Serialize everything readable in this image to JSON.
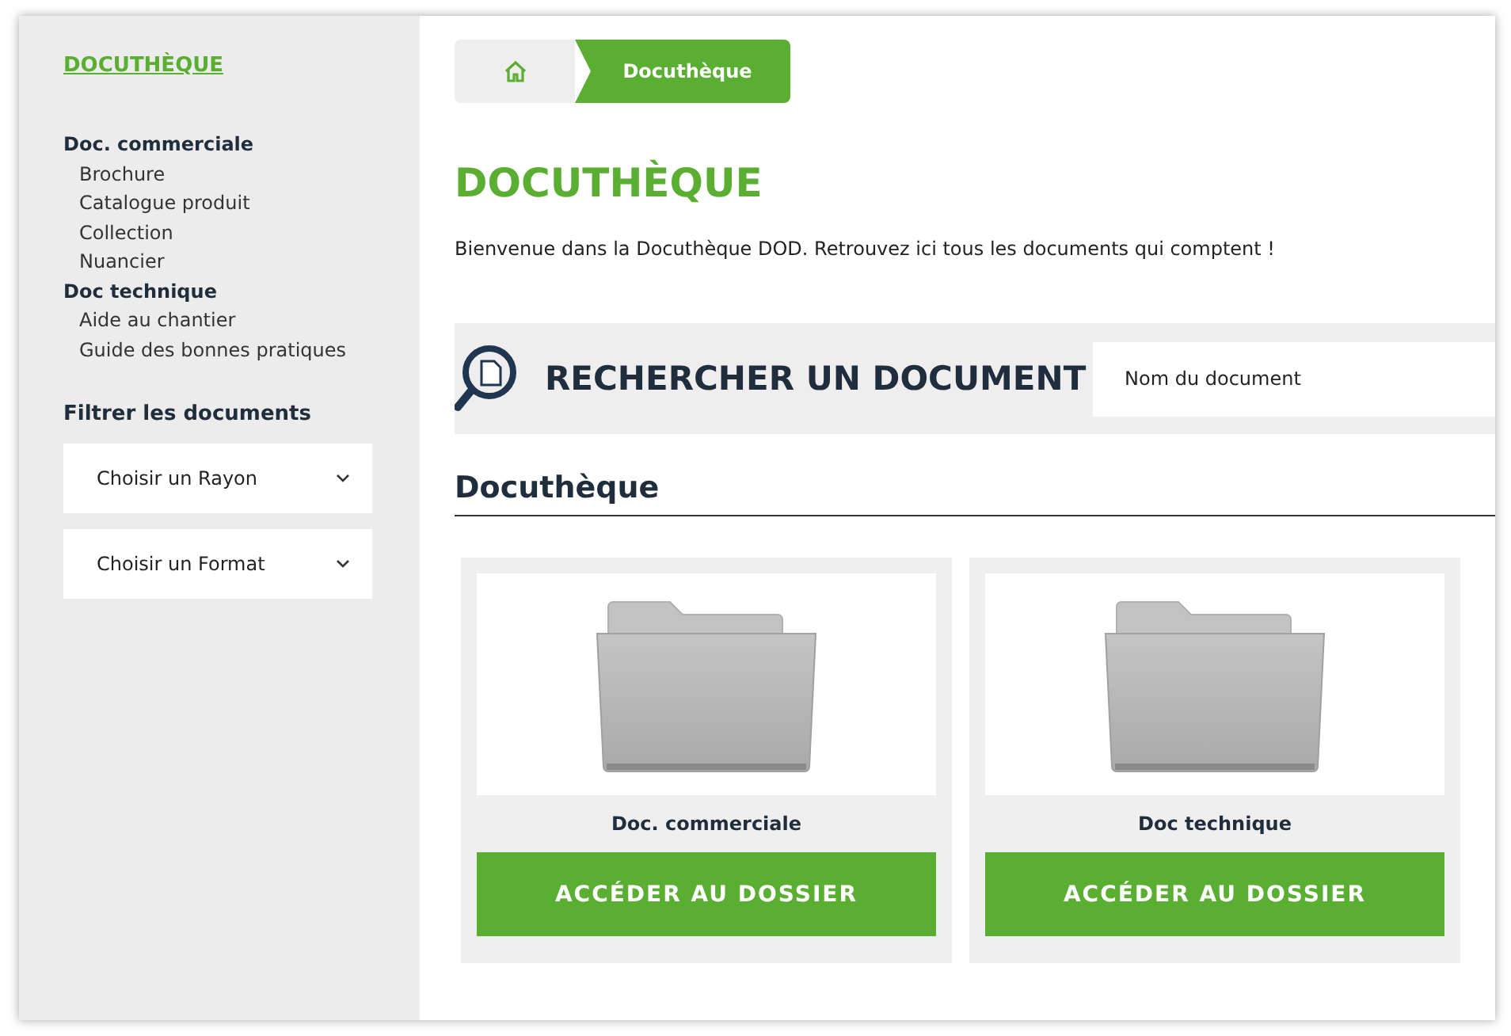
{
  "sidebar": {
    "title": "DOCUTHÈQUE",
    "tree": [
      {
        "label": "Doc. commerciale",
        "children": [
          {
            "label": "Brochure"
          },
          {
            "label": "Catalogue produit"
          },
          {
            "label": "Collection"
          },
          {
            "label": "Nuancier"
          }
        ]
      },
      {
        "label": "Doc technique",
        "children": [
          {
            "label": "Aide au chantier"
          },
          {
            "label": "Guide des bonnes pratiques"
          }
        ]
      }
    ],
    "filter_heading": "Filtrer les documents",
    "filters": [
      {
        "label": "Choisir un Rayon"
      },
      {
        "label": "Choisir un Format"
      }
    ]
  },
  "breadcrumb": {
    "current": "Docuthèque"
  },
  "page_title": "DOCUTHÈQUE",
  "intro": "Bienvenue dans la Docuthèque DOD. Retrouvez ici tous les documents qui comptent !",
  "search": {
    "heading": "RECHERCHER UN DOCUMENT",
    "placeholder": "Nom du document"
  },
  "section_title": "Docuthèque",
  "folders": [
    {
      "name": "Doc. commerciale",
      "button": "ACCÉDER AU DOSSIER"
    },
    {
      "name": "Doc technique",
      "button": "ACCÉDER AU DOSSIER"
    }
  ]
}
